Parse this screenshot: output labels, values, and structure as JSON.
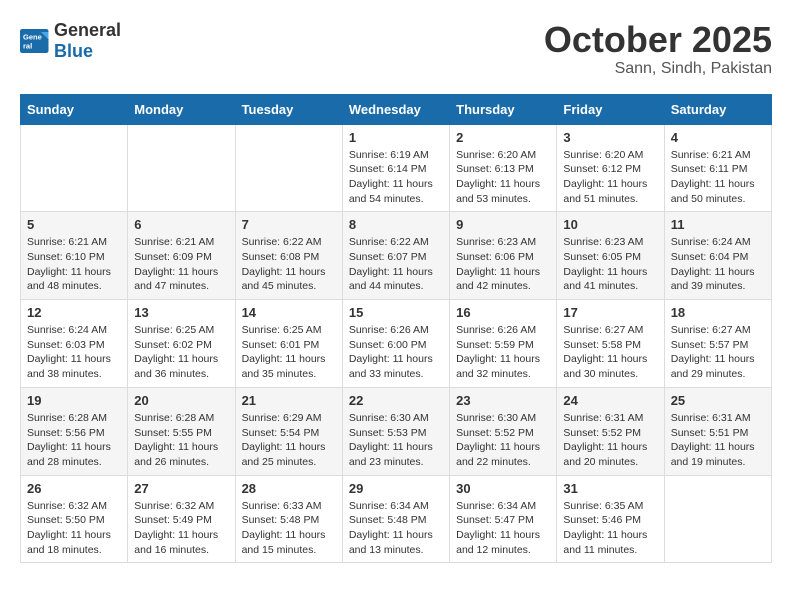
{
  "logo": {
    "general": "General",
    "blue": "Blue"
  },
  "header": {
    "month": "October 2025",
    "location": "Sann, Sindh, Pakistan"
  },
  "days_of_week": [
    "Sunday",
    "Monday",
    "Tuesday",
    "Wednesday",
    "Thursday",
    "Friday",
    "Saturday"
  ],
  "weeks": [
    [
      {
        "day": "",
        "content": ""
      },
      {
        "day": "",
        "content": ""
      },
      {
        "day": "",
        "content": ""
      },
      {
        "day": "1",
        "content": "Sunrise: 6:19 AM\nSunset: 6:14 PM\nDaylight: 11 hours and 54 minutes."
      },
      {
        "day": "2",
        "content": "Sunrise: 6:20 AM\nSunset: 6:13 PM\nDaylight: 11 hours and 53 minutes."
      },
      {
        "day": "3",
        "content": "Sunrise: 6:20 AM\nSunset: 6:12 PM\nDaylight: 11 hours and 51 minutes."
      },
      {
        "day": "4",
        "content": "Sunrise: 6:21 AM\nSunset: 6:11 PM\nDaylight: 11 hours and 50 minutes."
      }
    ],
    [
      {
        "day": "5",
        "content": "Sunrise: 6:21 AM\nSunset: 6:10 PM\nDaylight: 11 hours and 48 minutes."
      },
      {
        "day": "6",
        "content": "Sunrise: 6:21 AM\nSunset: 6:09 PM\nDaylight: 11 hours and 47 minutes."
      },
      {
        "day": "7",
        "content": "Sunrise: 6:22 AM\nSunset: 6:08 PM\nDaylight: 11 hours and 45 minutes."
      },
      {
        "day": "8",
        "content": "Sunrise: 6:22 AM\nSunset: 6:07 PM\nDaylight: 11 hours and 44 minutes."
      },
      {
        "day": "9",
        "content": "Sunrise: 6:23 AM\nSunset: 6:06 PM\nDaylight: 11 hours and 42 minutes."
      },
      {
        "day": "10",
        "content": "Sunrise: 6:23 AM\nSunset: 6:05 PM\nDaylight: 11 hours and 41 minutes."
      },
      {
        "day": "11",
        "content": "Sunrise: 6:24 AM\nSunset: 6:04 PM\nDaylight: 11 hours and 39 minutes."
      }
    ],
    [
      {
        "day": "12",
        "content": "Sunrise: 6:24 AM\nSunset: 6:03 PM\nDaylight: 11 hours and 38 minutes."
      },
      {
        "day": "13",
        "content": "Sunrise: 6:25 AM\nSunset: 6:02 PM\nDaylight: 11 hours and 36 minutes."
      },
      {
        "day": "14",
        "content": "Sunrise: 6:25 AM\nSunset: 6:01 PM\nDaylight: 11 hours and 35 minutes."
      },
      {
        "day": "15",
        "content": "Sunrise: 6:26 AM\nSunset: 6:00 PM\nDaylight: 11 hours and 33 minutes."
      },
      {
        "day": "16",
        "content": "Sunrise: 6:26 AM\nSunset: 5:59 PM\nDaylight: 11 hours and 32 minutes."
      },
      {
        "day": "17",
        "content": "Sunrise: 6:27 AM\nSunset: 5:58 PM\nDaylight: 11 hours and 30 minutes."
      },
      {
        "day": "18",
        "content": "Sunrise: 6:27 AM\nSunset: 5:57 PM\nDaylight: 11 hours and 29 minutes."
      }
    ],
    [
      {
        "day": "19",
        "content": "Sunrise: 6:28 AM\nSunset: 5:56 PM\nDaylight: 11 hours and 28 minutes."
      },
      {
        "day": "20",
        "content": "Sunrise: 6:28 AM\nSunset: 5:55 PM\nDaylight: 11 hours and 26 minutes."
      },
      {
        "day": "21",
        "content": "Sunrise: 6:29 AM\nSunset: 5:54 PM\nDaylight: 11 hours and 25 minutes."
      },
      {
        "day": "22",
        "content": "Sunrise: 6:30 AM\nSunset: 5:53 PM\nDaylight: 11 hours and 23 minutes."
      },
      {
        "day": "23",
        "content": "Sunrise: 6:30 AM\nSunset: 5:52 PM\nDaylight: 11 hours and 22 minutes."
      },
      {
        "day": "24",
        "content": "Sunrise: 6:31 AM\nSunset: 5:52 PM\nDaylight: 11 hours and 20 minutes."
      },
      {
        "day": "25",
        "content": "Sunrise: 6:31 AM\nSunset: 5:51 PM\nDaylight: 11 hours and 19 minutes."
      }
    ],
    [
      {
        "day": "26",
        "content": "Sunrise: 6:32 AM\nSunset: 5:50 PM\nDaylight: 11 hours and 18 minutes."
      },
      {
        "day": "27",
        "content": "Sunrise: 6:32 AM\nSunset: 5:49 PM\nDaylight: 11 hours and 16 minutes."
      },
      {
        "day": "28",
        "content": "Sunrise: 6:33 AM\nSunset: 5:48 PM\nDaylight: 11 hours and 15 minutes."
      },
      {
        "day": "29",
        "content": "Sunrise: 6:34 AM\nSunset: 5:48 PM\nDaylight: 11 hours and 13 minutes."
      },
      {
        "day": "30",
        "content": "Sunrise: 6:34 AM\nSunset: 5:47 PM\nDaylight: 11 hours and 12 minutes."
      },
      {
        "day": "31",
        "content": "Sunrise: 6:35 AM\nSunset: 5:46 PM\nDaylight: 11 hours and 11 minutes."
      },
      {
        "day": "",
        "content": ""
      }
    ]
  ]
}
